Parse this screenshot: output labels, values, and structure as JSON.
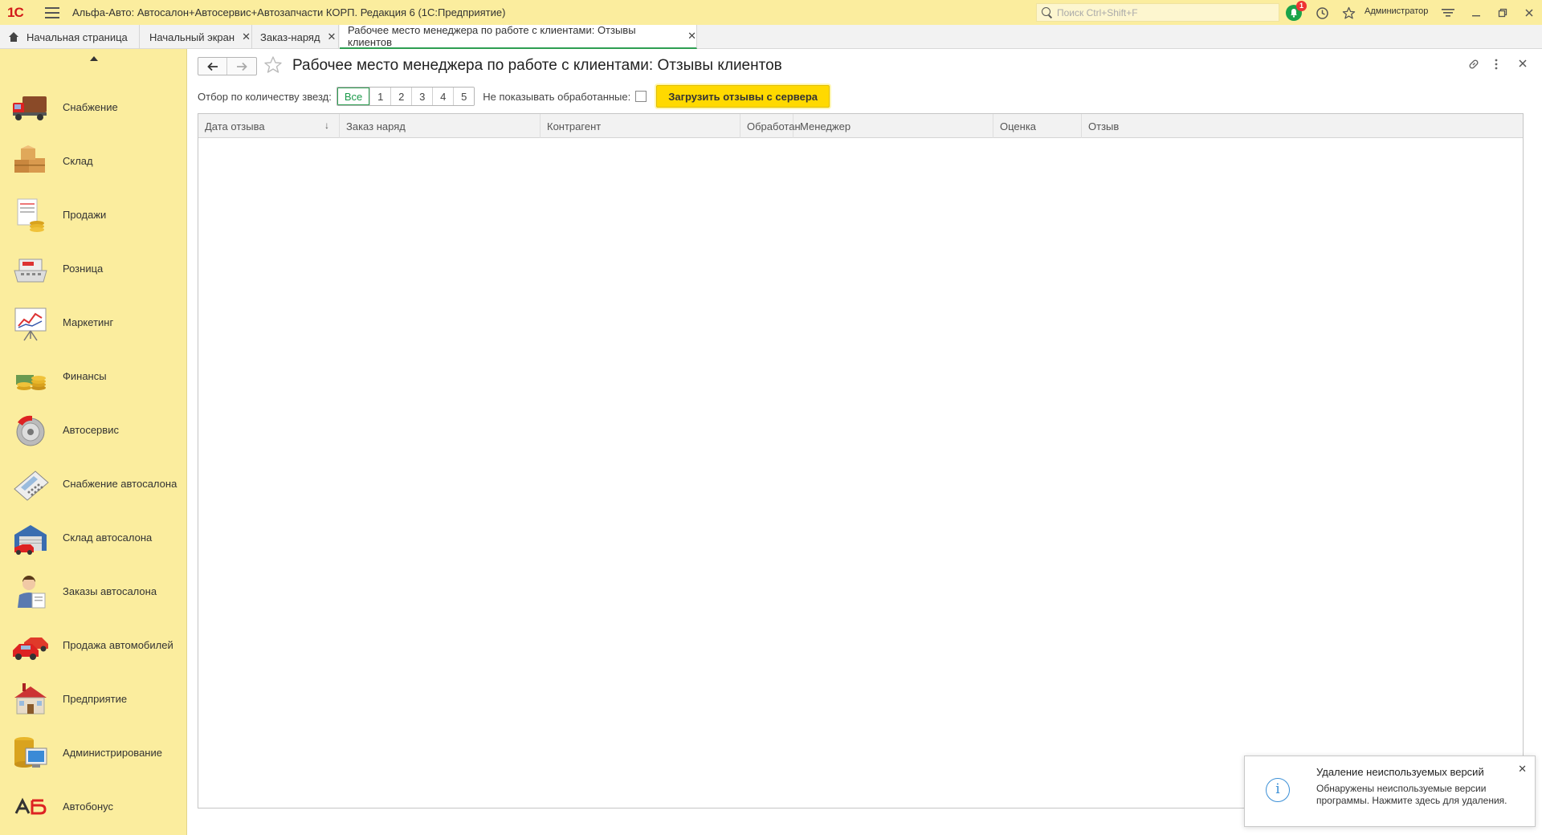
{
  "titlebar": {
    "app_title": "Альфа-Авто: Автосалон+Автосервис+Автозапчасти КОРП. Редакция 6  (1С:Предприятие)",
    "logo_text": "1С",
    "search_placeholder": "Поиск Ctrl+Shift+F",
    "notification_count": "1",
    "user": "Администратор"
  },
  "tabs": [
    {
      "label": "Начальная страница"
    },
    {
      "label": "Начальный экран"
    },
    {
      "label": "Заказ-наряд"
    },
    {
      "label": "Рабочее место менеджера по работе с клиентами: Отзывы клиентов"
    }
  ],
  "sidebar": {
    "items": [
      {
        "label": "Снабжение",
        "icon": "truck-icon"
      },
      {
        "label": "Склад",
        "icon": "boxes-icon"
      },
      {
        "label": "Продажи",
        "icon": "sales-icon"
      },
      {
        "label": "Розница",
        "icon": "cash-register-icon"
      },
      {
        "label": "Маркетинг",
        "icon": "chart-board-icon"
      },
      {
        "label": "Финансы",
        "icon": "coins-icon"
      },
      {
        "label": "Автосервис",
        "icon": "brake-disc-icon"
      },
      {
        "label": "Снабжение автосалона",
        "icon": "calculator-icon"
      },
      {
        "label": "Склад автосалона",
        "icon": "garage-icon"
      },
      {
        "label": "Заказы автосалона",
        "icon": "manager-icon"
      },
      {
        "label": "Продажа автомобилей",
        "icon": "cars-icon"
      },
      {
        "label": "Предприятие",
        "icon": "building-icon"
      },
      {
        "label": "Администрирование",
        "icon": "computer-icon"
      },
      {
        "label": "Автобонус",
        "icon": "autobonus-icon"
      }
    ]
  },
  "page": {
    "title": "Рабочее место менеджера по работе с клиентами: Отзывы клиентов",
    "filter_label": "Отбор по количеству звезд:",
    "star_buttons": [
      "Все",
      "1",
      "2",
      "3",
      "4",
      "5"
    ],
    "hide_processed_label": "Не показывать обработанные:",
    "hide_processed_checked": false,
    "load_button": "Загрузить отзывы с сервера"
  },
  "table": {
    "columns": [
      "Дата отзыва",
      "Заказ наряд",
      "Контрагент",
      "Обработан",
      "Менеджер",
      "Оценка",
      "Отзыв"
    ],
    "sort_indicator": "↓",
    "rows": []
  },
  "toast": {
    "title": "Удаление неиспользуемых версий",
    "body": "Обнаружены неиспользуемые версии программы. Нажмите здесь для удаления."
  },
  "colors": {
    "titlebar_bg": "#fbed9e",
    "accent_green": "#2e9e52",
    "button_yellow": "#ffd900",
    "info_blue": "#3b8fd6"
  }
}
